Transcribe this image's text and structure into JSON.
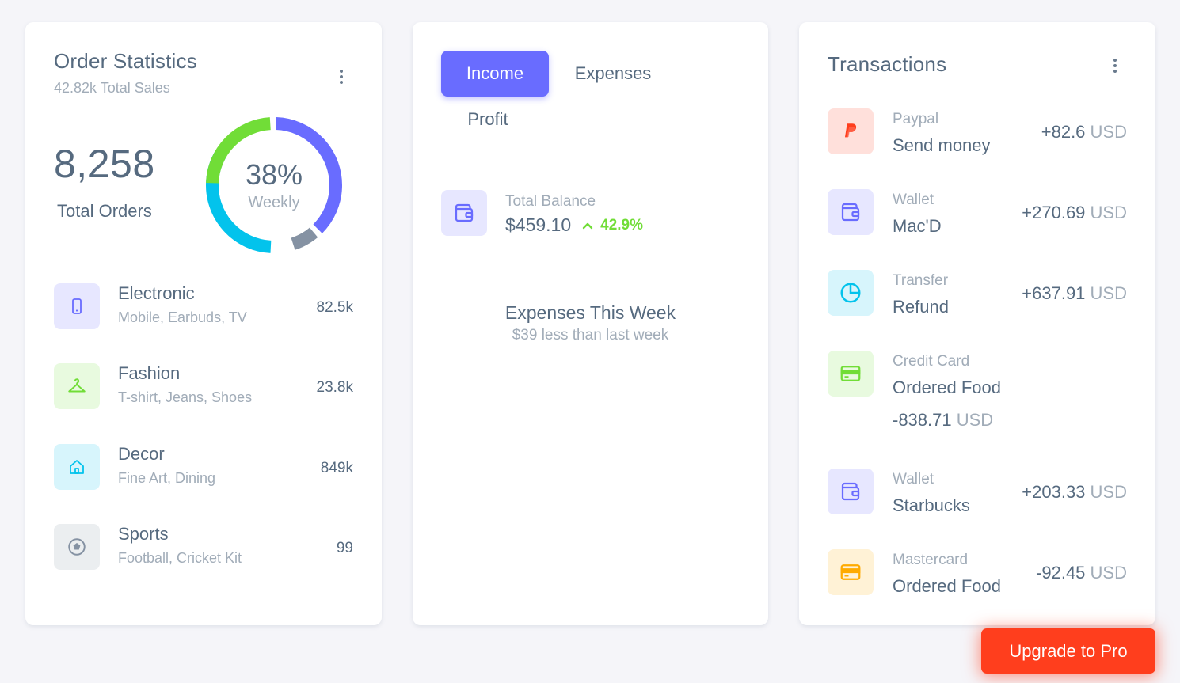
{
  "order_statistics": {
    "title": "Order Statistics",
    "subtitle": "42.82k Total Sales",
    "total_orders_value": "8,258",
    "total_orders_label": "Total Orders",
    "donut_percent": "38%",
    "donut_label": "Weekly",
    "donut_colors": [
      "#696cff",
      "#8592a3",
      "#03c3ec",
      "#71dd37"
    ],
    "categories": [
      {
        "name": "Electronic",
        "sub": "Mobile, Earbuds, TV",
        "value": "82.5k",
        "icon": "mobile-icon"
      },
      {
        "name": "Fashion",
        "sub": "T-shirt, Jeans, Shoes",
        "value": "23.8k",
        "icon": "hanger-icon"
      },
      {
        "name": "Decor",
        "sub": "Fine Art, Dining",
        "value": "849k",
        "icon": "home-icon"
      },
      {
        "name": "Sports",
        "sub": "Football, Cricket Kit",
        "value": "99",
        "icon": "football-icon"
      }
    ]
  },
  "income_card": {
    "tabs": [
      "Income",
      "Expenses",
      "Profit"
    ],
    "active_tab": "Income",
    "balance_label": "Total Balance",
    "balance_value": "$459.10",
    "balance_change": "42.9%",
    "expenses_title": "Expenses This Week",
    "expenses_sub": "$39 less than last week"
  },
  "transactions": {
    "title": "Transactions",
    "items": [
      {
        "source": "Paypal",
        "desc": "Send money",
        "amount": "+82.6",
        "currency": "USD",
        "icon": "paypal-icon"
      },
      {
        "source": "Wallet",
        "desc": "Mac'D",
        "amount": "+270.69",
        "currency": "USD",
        "icon": "wallet-icon"
      },
      {
        "source": "Transfer",
        "desc": "Refund",
        "amount": "+637.91",
        "currency": "USD",
        "icon": "pie-chart-icon"
      },
      {
        "source": "Credit Card",
        "desc": "Ordered Food",
        "amount": "-838.71",
        "currency": "USD",
        "icon": "credit-card-icon"
      },
      {
        "source": "Wallet",
        "desc": "Starbucks",
        "amount": "+203.33",
        "currency": "USD",
        "icon": "wallet-icon"
      },
      {
        "source": "Mastercard",
        "desc": "Ordered Food",
        "amount": "-92.45",
        "currency": "USD",
        "icon": "credit-card-icon"
      }
    ]
  },
  "upgrade_button": "Upgrade to Pro",
  "colors": {
    "primary": "#696cff",
    "success": "#71dd37",
    "info": "#03c3ec",
    "secondary": "#8592a3",
    "danger": "#ff3e1d",
    "warning": "#ffab00"
  }
}
